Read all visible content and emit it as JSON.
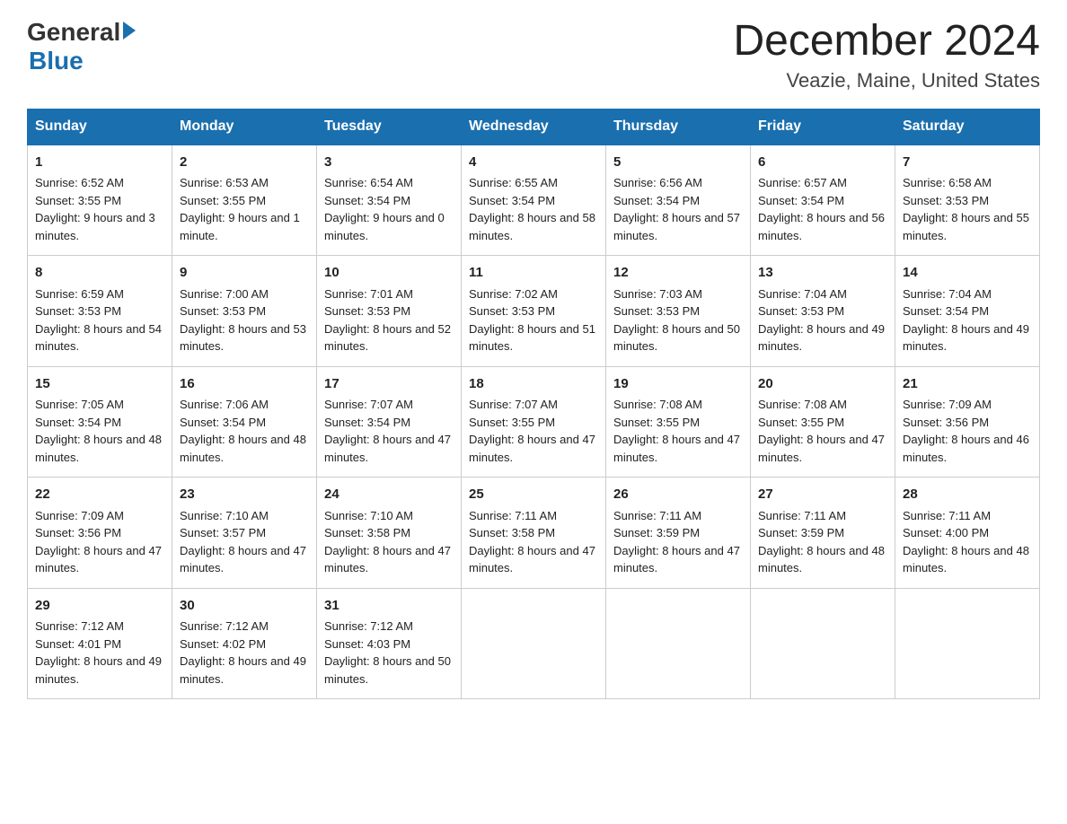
{
  "logo": {
    "general": "General",
    "blue": "Blue"
  },
  "title": "December 2024",
  "subtitle": "Veazie, Maine, United States",
  "days_of_week": [
    "Sunday",
    "Monday",
    "Tuesday",
    "Wednesday",
    "Thursday",
    "Friday",
    "Saturday"
  ],
  "weeks": [
    [
      {
        "day": "1",
        "sunrise": "6:52 AM",
        "sunset": "3:55 PM",
        "daylight": "9 hours and 3 minutes."
      },
      {
        "day": "2",
        "sunrise": "6:53 AM",
        "sunset": "3:55 PM",
        "daylight": "9 hours and 1 minute."
      },
      {
        "day": "3",
        "sunrise": "6:54 AM",
        "sunset": "3:54 PM",
        "daylight": "9 hours and 0 minutes."
      },
      {
        "day": "4",
        "sunrise": "6:55 AM",
        "sunset": "3:54 PM",
        "daylight": "8 hours and 58 minutes."
      },
      {
        "day": "5",
        "sunrise": "6:56 AM",
        "sunset": "3:54 PM",
        "daylight": "8 hours and 57 minutes."
      },
      {
        "day": "6",
        "sunrise": "6:57 AM",
        "sunset": "3:54 PM",
        "daylight": "8 hours and 56 minutes."
      },
      {
        "day": "7",
        "sunrise": "6:58 AM",
        "sunset": "3:53 PM",
        "daylight": "8 hours and 55 minutes."
      }
    ],
    [
      {
        "day": "8",
        "sunrise": "6:59 AM",
        "sunset": "3:53 PM",
        "daylight": "8 hours and 54 minutes."
      },
      {
        "day": "9",
        "sunrise": "7:00 AM",
        "sunset": "3:53 PM",
        "daylight": "8 hours and 53 minutes."
      },
      {
        "day": "10",
        "sunrise": "7:01 AM",
        "sunset": "3:53 PM",
        "daylight": "8 hours and 52 minutes."
      },
      {
        "day": "11",
        "sunrise": "7:02 AM",
        "sunset": "3:53 PM",
        "daylight": "8 hours and 51 minutes."
      },
      {
        "day": "12",
        "sunrise": "7:03 AM",
        "sunset": "3:53 PM",
        "daylight": "8 hours and 50 minutes."
      },
      {
        "day": "13",
        "sunrise": "7:04 AM",
        "sunset": "3:53 PM",
        "daylight": "8 hours and 49 minutes."
      },
      {
        "day": "14",
        "sunrise": "7:04 AM",
        "sunset": "3:54 PM",
        "daylight": "8 hours and 49 minutes."
      }
    ],
    [
      {
        "day": "15",
        "sunrise": "7:05 AM",
        "sunset": "3:54 PM",
        "daylight": "8 hours and 48 minutes."
      },
      {
        "day": "16",
        "sunrise": "7:06 AM",
        "sunset": "3:54 PM",
        "daylight": "8 hours and 48 minutes."
      },
      {
        "day": "17",
        "sunrise": "7:07 AM",
        "sunset": "3:54 PM",
        "daylight": "8 hours and 47 minutes."
      },
      {
        "day": "18",
        "sunrise": "7:07 AM",
        "sunset": "3:55 PM",
        "daylight": "8 hours and 47 minutes."
      },
      {
        "day": "19",
        "sunrise": "7:08 AM",
        "sunset": "3:55 PM",
        "daylight": "8 hours and 47 minutes."
      },
      {
        "day": "20",
        "sunrise": "7:08 AM",
        "sunset": "3:55 PM",
        "daylight": "8 hours and 47 minutes."
      },
      {
        "day": "21",
        "sunrise": "7:09 AM",
        "sunset": "3:56 PM",
        "daylight": "8 hours and 46 minutes."
      }
    ],
    [
      {
        "day": "22",
        "sunrise": "7:09 AM",
        "sunset": "3:56 PM",
        "daylight": "8 hours and 47 minutes."
      },
      {
        "day": "23",
        "sunrise": "7:10 AM",
        "sunset": "3:57 PM",
        "daylight": "8 hours and 47 minutes."
      },
      {
        "day": "24",
        "sunrise": "7:10 AM",
        "sunset": "3:58 PM",
        "daylight": "8 hours and 47 minutes."
      },
      {
        "day": "25",
        "sunrise": "7:11 AM",
        "sunset": "3:58 PM",
        "daylight": "8 hours and 47 minutes."
      },
      {
        "day": "26",
        "sunrise": "7:11 AM",
        "sunset": "3:59 PM",
        "daylight": "8 hours and 47 minutes."
      },
      {
        "day": "27",
        "sunrise": "7:11 AM",
        "sunset": "3:59 PM",
        "daylight": "8 hours and 48 minutes."
      },
      {
        "day": "28",
        "sunrise": "7:11 AM",
        "sunset": "4:00 PM",
        "daylight": "8 hours and 48 minutes."
      }
    ],
    [
      {
        "day": "29",
        "sunrise": "7:12 AM",
        "sunset": "4:01 PM",
        "daylight": "8 hours and 49 minutes."
      },
      {
        "day": "30",
        "sunrise": "7:12 AM",
        "sunset": "4:02 PM",
        "daylight": "8 hours and 49 minutes."
      },
      {
        "day": "31",
        "sunrise": "7:12 AM",
        "sunset": "4:03 PM",
        "daylight": "8 hours and 50 minutes."
      },
      null,
      null,
      null,
      null
    ]
  ]
}
